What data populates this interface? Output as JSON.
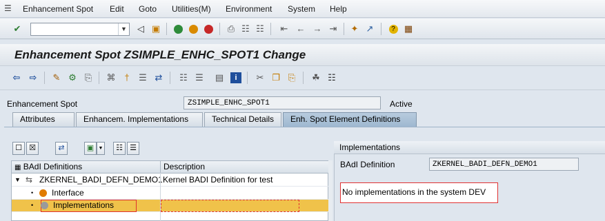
{
  "menu": {
    "items": [
      "Enhancement Spot",
      "Edit",
      "Goto",
      "Utilities(M)",
      "Environment",
      "System",
      "Help"
    ]
  },
  "toolbar": {
    "command_value": "",
    "icons": [
      "check-icon",
      "back-icon",
      "save-icon",
      "back-green-icon",
      "exit-icon",
      "cancel-icon",
      "print-icon",
      "find-icon",
      "find-next-icon",
      "first-page-icon",
      "prev-page-icon",
      "next-page-icon",
      "last-page-icon",
      "create-session-icon",
      "shortcut-icon",
      "help-icon",
      "layout-icon"
    ]
  },
  "title": "Enhancement Spot ZSIMPLE_ENHC_SPOT1 Change",
  "app_toolbar": {
    "icons": [
      "back-arrow-icon",
      "forward-arrow-icon",
      "other-object-icon",
      "display-change-icon",
      "check-object-icon",
      "activate-icon",
      "where-used-icon",
      "display-object-list-icon",
      "navigation-window-icon",
      "object-list-icon",
      "info-icon",
      "cut-icon",
      "copy-icon",
      "paste-icon",
      "hierarchy-icon",
      "find-object-icon"
    ]
  },
  "header": {
    "label": "Enhancement Spot",
    "value": "ZSIMPLE_ENHC_SPOT1",
    "status": "Active"
  },
  "tabs": [
    {
      "label": "Attributes",
      "active": false
    },
    {
      "label": "Enhancem. Implementations",
      "active": false
    },
    {
      "label": "Technical Details",
      "active": false
    },
    {
      "label": "Enh. Spot Element Definitions",
      "active": true
    }
  ],
  "left": {
    "toolbar_icons": [
      "create-icon",
      "delete-icon",
      "navigate-icon",
      "display-icon",
      "dropdown-icon",
      "find-icon",
      "details-icon"
    ],
    "columns": [
      "BAdI Definitions",
      "Description"
    ],
    "rows": [
      {
        "name": "ZKERNEL_BADI_DEFN_DEMO1",
        "description": "Kernel BADI Definition for test",
        "level": 0,
        "expanded": true
      },
      {
        "name": "Interface",
        "description": "",
        "level": 1
      },
      {
        "name": "Implementations",
        "description": "",
        "level": 1,
        "selected": true
      }
    ]
  },
  "right": {
    "header": "Implementations",
    "label": "BAdI Definition",
    "value": "ZKERNEL_BADI_DEFN_DEMO1",
    "message": "No implementations in the system DEV"
  },
  "colors": {
    "selection": "#f0c24a",
    "highlight_box": "#e03030",
    "active_tab": "#a9c0d6"
  }
}
